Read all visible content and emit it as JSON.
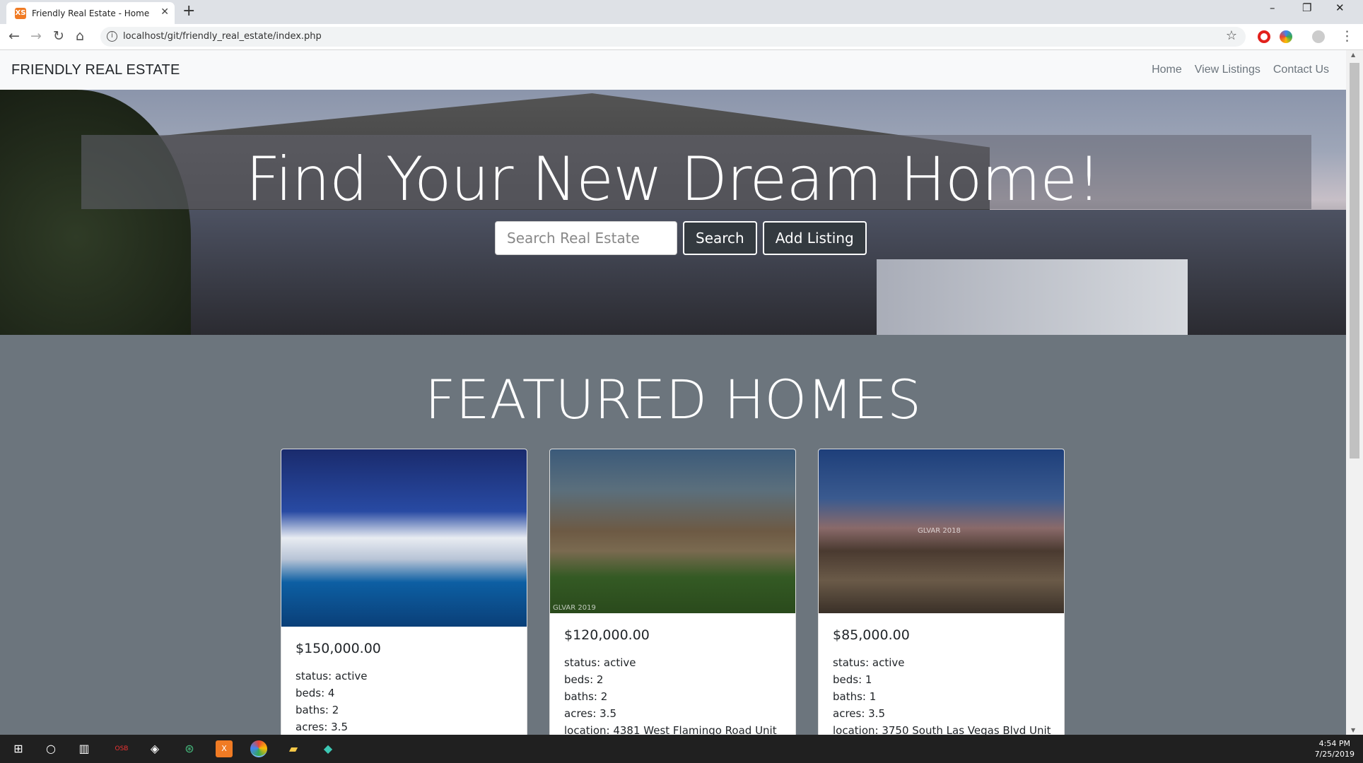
{
  "browser": {
    "tab_title": "Friendly Real Estate - Home",
    "favicon_text": "XS",
    "close_glyph": "✕",
    "new_tab_glyph": "+",
    "url": "localhost/git/friendly_real_estate/index.php",
    "window_controls": {
      "minimize": "–",
      "restore": "❐",
      "close": "✕"
    },
    "toolbar_glyphs": {
      "back": "←",
      "forward": "→",
      "reload": "↻",
      "home": "⌂",
      "star": "☆",
      "menu": "⋮",
      "info": "i"
    }
  },
  "site": {
    "brand": "FRIENDLY REAL ESTATE",
    "nav": [
      "Home",
      "View Listings",
      "Contact Us"
    ]
  },
  "hero": {
    "title": "Find Your New Dream Home!",
    "search_placeholder": "Search Real Estate",
    "search_button": "Search",
    "add_listing_button": "Add Listing"
  },
  "featured": {
    "title": "FEATURED HOMES",
    "cards": [
      {
        "price": "$150,000.00",
        "status": "status: active",
        "beds": "beds: 4",
        "baths": "baths: 2",
        "acres": "acres: 3.5",
        "watermark": ""
      },
      {
        "price": "$120,000.00",
        "status": "status: active",
        "beds": "beds: 2",
        "baths": "baths: 2",
        "acres": "acres: 3.5",
        "location": "location: 4381 West Flamingo Road Unit",
        "watermark": "GLVAR 2019"
      },
      {
        "price": "$85,000.00",
        "status": "status: active",
        "beds": "beds: 1",
        "baths": "baths: 1",
        "acres": "acres: 3.5",
        "location": "location: 3750 South Las Vegas Blvd Unit",
        "watermark": "GLVAR 2018"
      }
    ]
  },
  "taskbar": {
    "time": "4:54 PM",
    "date": "7/25/2019",
    "icons": [
      "windows-start-icon",
      "cortana-icon",
      "task-view-icon",
      "osb-icon",
      "game-icon",
      "sourcetree-icon",
      "xampp-icon",
      "chrome-icon",
      "explorer-icon",
      "gitkraken-icon"
    ]
  }
}
